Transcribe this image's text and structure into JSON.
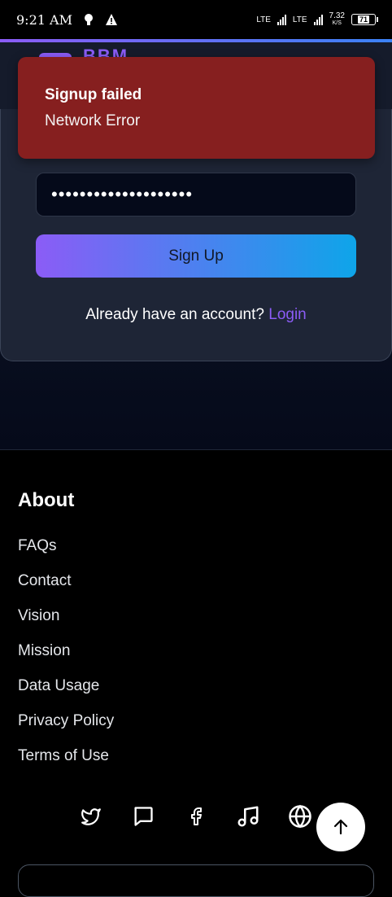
{
  "status_bar": {
    "time": "9:21 AM",
    "network_1": "LTE",
    "network_2": "LTE",
    "speed": "7.32",
    "speed_unit": "K/S",
    "battery": "71"
  },
  "header": {
    "logo_text": "BBM"
  },
  "toast": {
    "title": "Signup failed",
    "message": "Network Error"
  },
  "form": {
    "password_value": "••••••••••••••••••••",
    "signup_button": "Sign Up",
    "already_text": "Already have an account?",
    "login_link": "Login"
  },
  "footer": {
    "heading": "About",
    "links": [
      "FAQs",
      "Contact",
      "Vision",
      "Mission",
      "Data Usage",
      "Privacy Policy",
      "Terms of Use"
    ],
    "social_icons": [
      "twitter-icon",
      "message-icon",
      "facebook-icon",
      "music-icon",
      "globe-icon"
    ]
  },
  "colors": {
    "accent": "#8b5cf6",
    "error": "#861f1f",
    "gradient_end": "#0ea5e9"
  }
}
